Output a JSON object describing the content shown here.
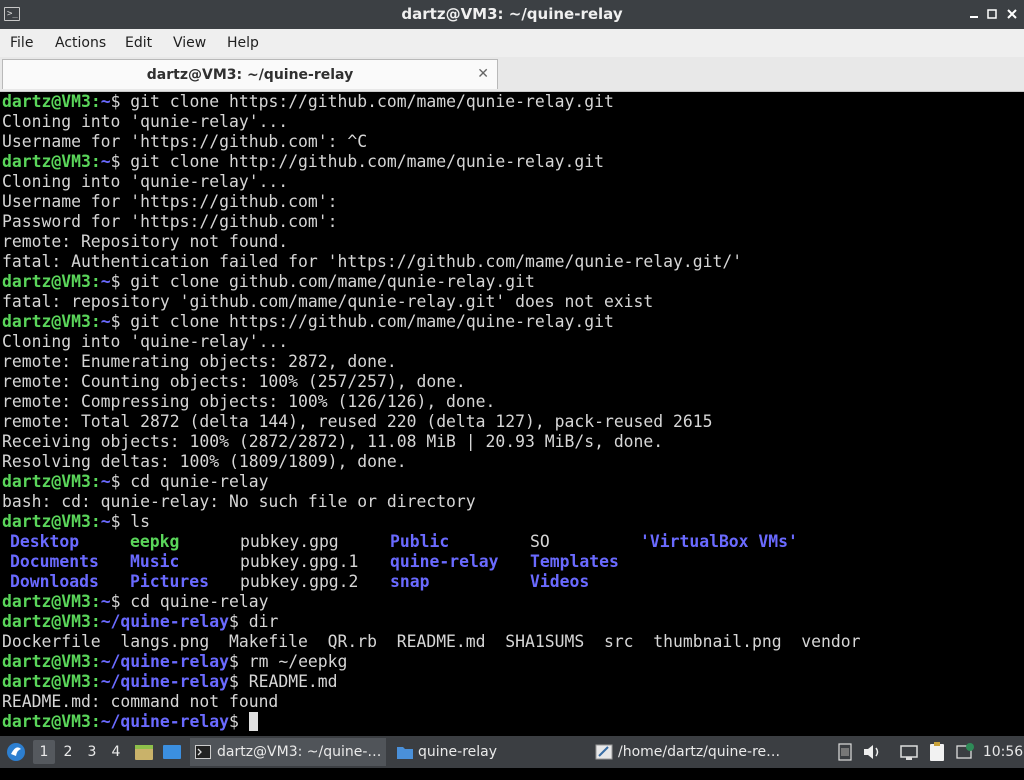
{
  "window": {
    "title": "dartz@VM3: ~/quine-relay",
    "controls": [
      "minimize-icon",
      "maximize-icon",
      "close-icon"
    ]
  },
  "menu": [
    "File",
    "Actions",
    "Edit",
    "View",
    "Help"
  ],
  "tab": {
    "label": "dartz@VM3: ~/quine-relay",
    "close": "✕"
  },
  "terminal": {
    "lines": [
      {
        "user": "dartz@VM3",
        "path": "~",
        "sep": "$",
        "cmd": " git clone https://github.com/mame/qunie-relay.git"
      },
      {
        "text": "Cloning into 'qunie-relay'..."
      },
      {
        "text": "Username for 'https://github.com': ^C"
      },
      {
        "user": "dartz@VM3",
        "path": "~",
        "sep": "$",
        "cmd": " git clone http://github.com/mame/qunie-relay.git"
      },
      {
        "text": "Cloning into 'qunie-relay'..."
      },
      {
        "text": "Username for 'https://github.com':"
      },
      {
        "text": "Password for 'https://github.com':"
      },
      {
        "text": "remote: Repository not found."
      },
      {
        "text": "fatal: Authentication failed for 'https://github.com/mame/qunie-relay.git/'"
      },
      {
        "user": "dartz@VM3",
        "path": "~",
        "sep": "$",
        "cmd": " git clone github.com/mame/qunie-relay.git"
      },
      {
        "text": "fatal: repository 'github.com/mame/qunie-relay.git' does not exist"
      },
      {
        "user": "dartz@VM3",
        "path": "~",
        "sep": "$",
        "cmd": " git clone https://github.com/mame/quine-relay.git"
      },
      {
        "text": "Cloning into 'quine-relay'..."
      },
      {
        "text": "remote: Enumerating objects: 2872, done."
      },
      {
        "text": "remote: Counting objects: 100% (257/257), done."
      },
      {
        "text": "remote: Compressing objects: 100% (126/126), done."
      },
      {
        "text": "remote: Total 2872 (delta 144), reused 220 (delta 127), pack-reused 2615"
      },
      {
        "text": "Receiving objects: 100% (2872/2872), 11.08 MiB | 20.93 MiB/s, done."
      },
      {
        "text": "Resolving deltas: 100% (1809/1809), done."
      },
      {
        "user": "dartz@VM3",
        "path": "~",
        "sep": "$",
        "cmd": " cd qunie-relay"
      },
      {
        "text": "bash: cd: qunie-relay: No such file or directory"
      },
      {
        "user": "dartz@VM3",
        "path": "~",
        "sep": "$",
        "cmd": " ls"
      },
      {
        "ls": [
          {
            "t": "Desktop",
            "c": "dir"
          },
          {
            "t": "eepkg",
            "c": "exe"
          },
          {
            "t": "pubkey.gpg",
            "c": ""
          },
          {
            "t": "Public",
            "c": "dir"
          },
          {
            "t": "SO",
            "c": ""
          },
          {
            "t": "'VirtualBox VMs'",
            "c": "dir"
          }
        ]
      },
      {
        "ls": [
          {
            "t": "Documents",
            "c": "dir"
          },
          {
            "t": "Music",
            "c": "dir"
          },
          {
            "t": "pubkey.gpg.1",
            "c": ""
          },
          {
            "t": "quine-relay",
            "c": "dir"
          },
          {
            "t": "Templates",
            "c": "dir"
          },
          {
            "t": "",
            "c": ""
          }
        ]
      },
      {
        "ls": [
          {
            "t": "Downloads",
            "c": "dir"
          },
          {
            "t": "Pictures",
            "c": "dir"
          },
          {
            "t": "pubkey.gpg.2",
            "c": ""
          },
          {
            "t": "snap",
            "c": "dir"
          },
          {
            "t": "Videos",
            "c": "dir"
          },
          {
            "t": "",
            "c": ""
          }
        ]
      },
      {
        "user": "dartz@VM3",
        "path": "~",
        "sep": "$",
        "cmd": " cd quine-relay"
      },
      {
        "user": "dartz@VM3",
        "path": "~/quine-relay",
        "sep": "$",
        "cmd": " dir"
      },
      {
        "text": "Dockerfile  langs.png  Makefile  QR.rb  README.md  SHA1SUMS  src  thumbnail.png  vendor"
      },
      {
        "user": "dartz@VM3",
        "path": "~/quine-relay",
        "sep": "$",
        "cmd": " rm ~/eepkg"
      },
      {
        "user": "dartz@VM3",
        "path": "~/quine-relay",
        "sep": "$",
        "cmd": " README.md"
      },
      {
        "text": "README.md: command not found"
      },
      {
        "user": "dartz@VM3",
        "path": "~/quine-relay",
        "sep": "$",
        "cmd": " ",
        "cursor": true
      }
    ]
  },
  "taskbar": {
    "desktops": [
      "1",
      "2",
      "3",
      "4"
    ],
    "tasks": [
      {
        "label": "dartz@VM3: ~/quine-…",
        "icon": "terminal-icon"
      },
      {
        "label": "quine-relay",
        "icon": "folder-icon"
      },
      {
        "label": "/home/dartz/quine-re…",
        "icon": "text-editor-icon"
      }
    ],
    "clock": "10:56"
  }
}
